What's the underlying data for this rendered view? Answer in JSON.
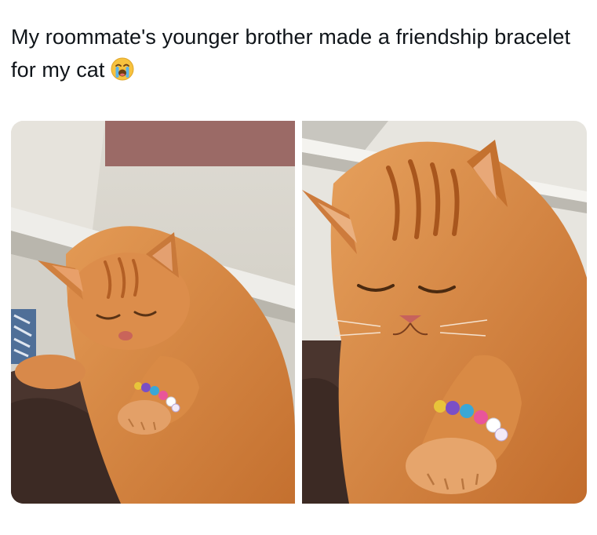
{
  "post": {
    "text": "My roommate's younger brother made a friendship bracelet for my cat",
    "emoji": "loudly-crying-face-emoji"
  },
  "media": {
    "photos": [
      {
        "name": "photo-cat-bracelet-wide"
      },
      {
        "name": "photo-cat-bracelet-closeup"
      }
    ],
    "colors": {
      "fur": "#d98a45",
      "fur_dark": "#b8652a",
      "bead_pink": "#e9559a",
      "bead_blue": "#3aa7d6",
      "bead_purple": "#7a4fc6",
      "bead_yellow": "#e8c43a"
    }
  }
}
